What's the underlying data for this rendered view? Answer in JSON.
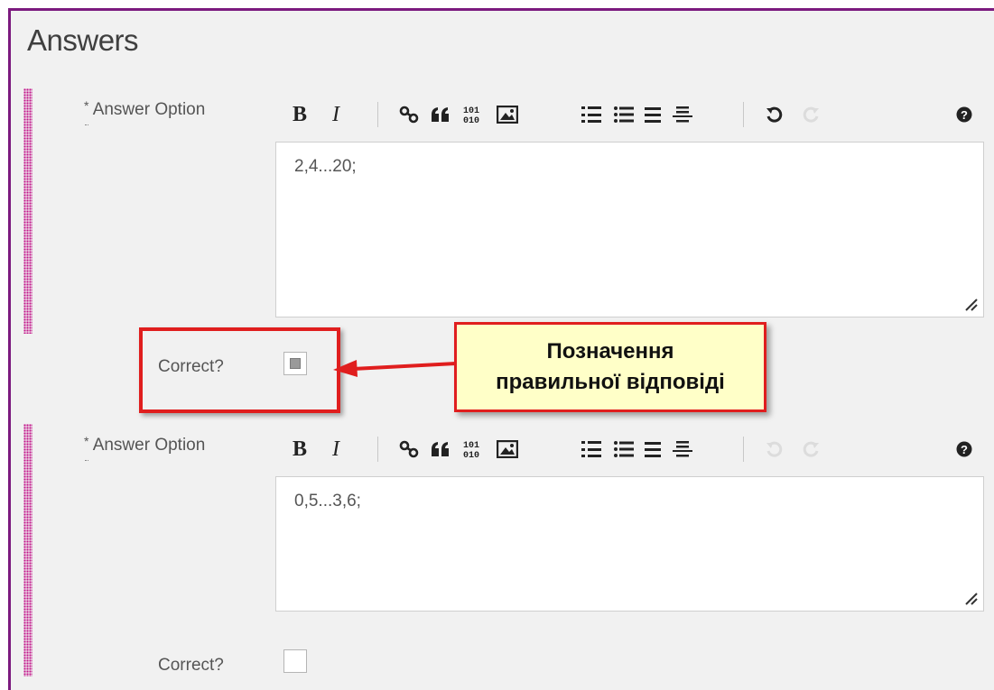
{
  "section": {
    "title": "Answers"
  },
  "answers": [
    {
      "label_required": "*",
      "label": "Answer Option",
      "value": "2,4...20;",
      "correct_label": "Correct?",
      "correct_checked": true
    },
    {
      "label_required": "*",
      "label": "Answer Option",
      "value": "0,5...3,6;",
      "correct_label": "Correct?",
      "correct_checked": false
    }
  ],
  "toolbar": {
    "bold": "B",
    "italic": "I",
    "icons": [
      "link-icon",
      "quote-icon",
      "code-icon",
      "image-icon",
      "numbered-list-icon",
      "bullet-list-icon",
      "align-icon",
      "horizontal-rule-icon",
      "undo-icon",
      "redo-icon",
      "help-icon"
    ]
  },
  "annotation": {
    "line1": "Позначення",
    "line2": "правильної відповіді"
  },
  "colors": {
    "accent_border": "#7b1a7e",
    "drag_handle": "#c2188c",
    "annotation_red": "#e01e1e",
    "annotation_fill": "#ffffc8"
  }
}
